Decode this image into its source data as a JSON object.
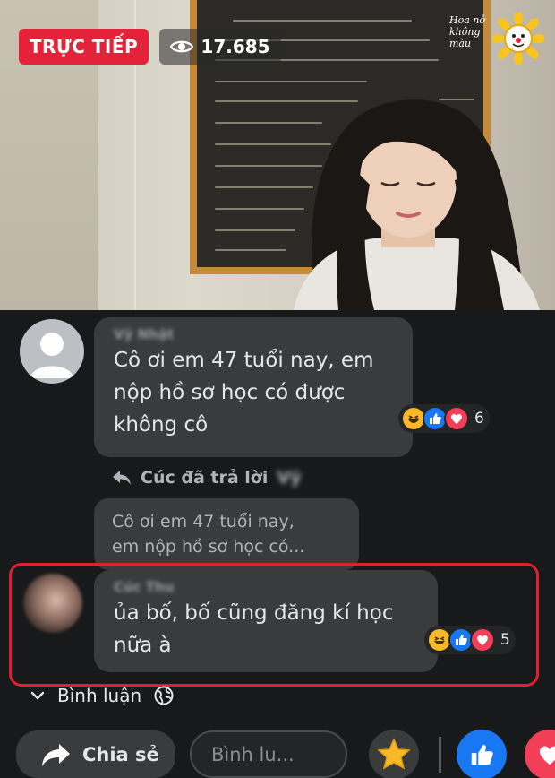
{
  "live": {
    "badge_label": "TRỰC TIẾP",
    "view_count": "17.685"
  },
  "channel_logo": {
    "text_line1": "Hoa nở",
    "text_line2": "không màu"
  },
  "comments": [
    {
      "author": "Vỹ Nhật",
      "text_lines": [
        "Cô ơi em 47 tuổi nay, em",
        "nộp hồ sơ học có được",
        "không cô"
      ],
      "reactions": [
        "haha",
        "like",
        "love"
      ],
      "reaction_count": "6"
    },
    {
      "author": "Cúc Thu",
      "text_lines": [
        "ủa bố, bố cũng đăng kí học",
        "nữa à"
      ],
      "reactions": [
        "haha",
        "like",
        "love"
      ],
      "reaction_count": "5"
    }
  ],
  "reply": {
    "label": "Cúc đã trả lời",
    "target": "Vỹ",
    "quoted_lines": [
      "Cô ơi em 47 tuổi nay,",
      "em nộp hồ sơ học có..."
    ]
  },
  "comments_toggle": {
    "label": "Bình luận"
  },
  "bottom_bar": {
    "share_label": "Chia sẻ",
    "comment_placeholder": "Bình lu..."
  },
  "colors": {
    "live_red": "#e4223a",
    "highlight_red": "#e0202f",
    "like_blue": "#1877f2",
    "love_red": "#f33e58",
    "haha_yellow": "#f7b928"
  }
}
